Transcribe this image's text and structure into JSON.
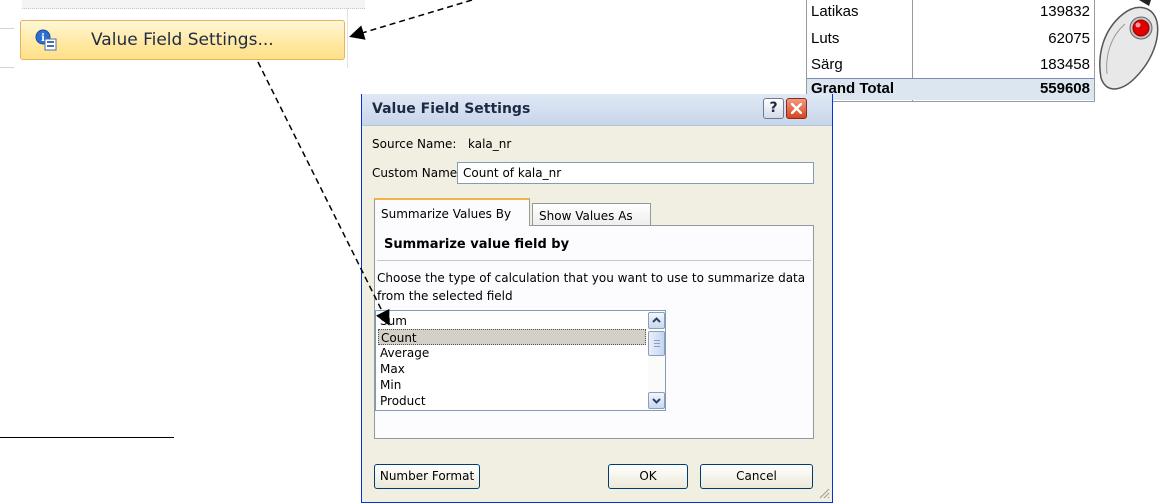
{
  "context_menu": {
    "item_label": "Value Field Settings...",
    "icon": "field-settings-icon"
  },
  "pivot_table": {
    "rows": [
      {
        "label": "Latikas",
        "value": "139832"
      },
      {
        "label": "Luts",
        "value": "62075"
      },
      {
        "label": "Särg",
        "value": "183458"
      }
    ],
    "total": {
      "label": "Grand Total",
      "value": "559608"
    },
    "icon": "mouse-icon"
  },
  "dialog": {
    "title": "Value Field Settings",
    "source_name_label": "Source Name:",
    "source_name_value": "kala_nr",
    "custom_name_label": "Custom Name:",
    "custom_name_value": "Count of kala_nr",
    "tabs": [
      {
        "label": "Summarize Values By",
        "active": true
      },
      {
        "label": "Show Values As",
        "active": false
      }
    ],
    "panel_heading": "Summarize value field by",
    "panel_description": "Choose the type of calculation that you want to use to summarize data from the selected field",
    "list_items": [
      "Sum",
      "Count",
      "Average",
      "Max",
      "Min",
      "Product"
    ],
    "selected_item": "Count",
    "buttons": {
      "number_format": "Number Format",
      "ok": "OK",
      "cancel": "Cancel"
    },
    "help_label": "?"
  }
}
